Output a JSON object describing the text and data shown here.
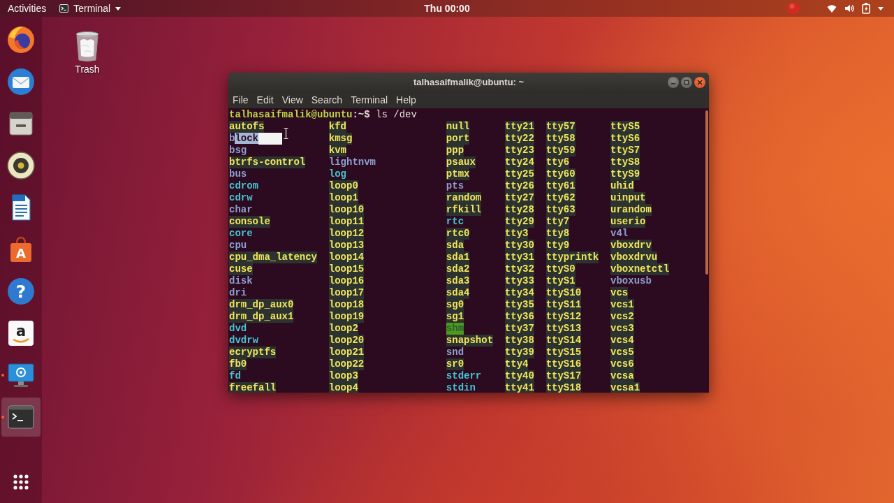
{
  "top_bar": {
    "activities": "Activities",
    "app_menu": "Terminal",
    "clock": "Thu 00:00"
  },
  "dock": {
    "items": [
      {
        "kind": "browser",
        "running": false,
        "active": false
      },
      {
        "kind": "mail",
        "running": false,
        "active": false
      },
      {
        "kind": "files",
        "running": false,
        "active": false
      },
      {
        "kind": "music",
        "running": false,
        "active": false
      },
      {
        "kind": "writer",
        "running": false,
        "active": false
      },
      {
        "kind": "store",
        "glyph": "A",
        "running": false,
        "active": false
      },
      {
        "kind": "help",
        "glyph": "?",
        "running": false,
        "active": false
      },
      {
        "kind": "amazon",
        "glyph": "a",
        "running": false,
        "active": false
      },
      {
        "kind": "screenshot",
        "running": true,
        "active": false
      },
      {
        "kind": "terminal",
        "running": true,
        "active": true
      }
    ]
  },
  "desktop_icons": [
    {
      "kind": "trash",
      "label": "Trash"
    }
  ],
  "terminal": {
    "title": "talhasaifmalik@ubuntu: ~",
    "menu": [
      "File",
      "Edit",
      "View",
      "Search",
      "Terminal",
      "Help"
    ],
    "prompt_user": "talhasaifmalik@ubuntu",
    "prompt_path": ":~$",
    "command": "ls /dev",
    "listing": {
      "columns": [
        {
          "entries": [
            {
              "name": "autofs",
              "kind": "device",
              "selected": false
            },
            {
              "name": "block",
              "kind": "directory",
              "selected": true
            },
            {
              "name": "bsg",
              "kind": "directory",
              "selected": false
            },
            {
              "name": "btrfs-control",
              "kind": "device",
              "selected": false
            },
            {
              "name": "bus",
              "kind": "directory",
              "selected": false
            },
            {
              "name": "cdrom",
              "kind": "symlink",
              "selected": false
            },
            {
              "name": "cdrw",
              "kind": "symlink",
              "selected": false
            },
            {
              "name": "char",
              "kind": "directory",
              "selected": false
            },
            {
              "name": "console",
              "kind": "device",
              "selected": false
            },
            {
              "name": "core",
              "kind": "symlink",
              "selected": false
            },
            {
              "name": "cpu",
              "kind": "directory",
              "selected": false
            },
            {
              "name": "cpu_dma_latency",
              "kind": "device",
              "selected": false
            },
            {
              "name": "cuse",
              "kind": "device",
              "selected": false
            },
            {
              "name": "disk",
              "kind": "directory",
              "selected": false
            },
            {
              "name": "dri",
              "kind": "directory",
              "selected": false
            },
            {
              "name": "drm_dp_aux0",
              "kind": "device",
              "selected": false
            },
            {
              "name": "drm_dp_aux1",
              "kind": "device",
              "selected": false
            },
            {
              "name": "dvd",
              "kind": "symlink",
              "selected": false
            },
            {
              "name": "dvdrw",
              "kind": "symlink",
              "selected": false
            },
            {
              "name": "ecryptfs",
              "kind": "device",
              "selected": false
            },
            {
              "name": "fb0",
              "kind": "device",
              "selected": false
            },
            {
              "name": "fd",
              "kind": "symlink",
              "selected": false
            },
            {
              "name": "freefall",
              "kind": "device",
              "selected": false
            }
          ]
        },
        {
          "entries": [
            {
              "name": "kfd",
              "kind": "device",
              "selected": false
            },
            {
              "name": "kmsg",
              "kind": "device",
              "selected": false
            },
            {
              "name": "kvm",
              "kind": "device",
              "selected": false
            },
            {
              "name": "lightnvm",
              "kind": "directory",
              "selected": false
            },
            {
              "name": "log",
              "kind": "symlink",
              "selected": false
            },
            {
              "name": "loop0",
              "kind": "device",
              "selected": false
            },
            {
              "name": "loop1",
              "kind": "device",
              "selected": false
            },
            {
              "name": "loop10",
              "kind": "device",
              "selected": false
            },
            {
              "name": "loop11",
              "kind": "device",
              "selected": false
            },
            {
              "name": "loop12",
              "kind": "device",
              "selected": false
            },
            {
              "name": "loop13",
              "kind": "device",
              "selected": false
            },
            {
              "name": "loop14",
              "kind": "device",
              "selected": false
            },
            {
              "name": "loop15",
              "kind": "device",
              "selected": false
            },
            {
              "name": "loop16",
              "kind": "device",
              "selected": false
            },
            {
              "name": "loop17",
              "kind": "device",
              "selected": false
            },
            {
              "name": "loop18",
              "kind": "device",
              "selected": false
            },
            {
              "name": "loop19",
              "kind": "device",
              "selected": false
            },
            {
              "name": "loop2",
              "kind": "device",
              "selected": false
            },
            {
              "name": "loop20",
              "kind": "device",
              "selected": false
            },
            {
              "name": "loop21",
              "kind": "device",
              "selected": false
            },
            {
              "name": "loop22",
              "kind": "device",
              "selected": false
            },
            {
              "name": "loop3",
              "kind": "device",
              "selected": false
            },
            {
              "name": "loop4",
              "kind": "device",
              "selected": false
            }
          ]
        },
        {
          "entries": [
            {
              "name": "null",
              "kind": "device",
              "selected": false
            },
            {
              "name": "port",
              "kind": "device",
              "selected": false
            },
            {
              "name": "ppp",
              "kind": "device",
              "selected": false
            },
            {
              "name": "psaux",
              "kind": "device",
              "selected": false
            },
            {
              "name": "ptmx",
              "kind": "device",
              "selected": false
            },
            {
              "name": "pts",
              "kind": "directory",
              "selected": false
            },
            {
              "name": "random",
              "kind": "device",
              "selected": false
            },
            {
              "name": "rfkill",
              "kind": "device",
              "selected": false
            },
            {
              "name": "rtc",
              "kind": "symlink",
              "selected": false
            },
            {
              "name": "rtc0",
              "kind": "device",
              "selected": false
            },
            {
              "name": "sda",
              "kind": "device",
              "selected": false
            },
            {
              "name": "sda1",
              "kind": "device",
              "selected": false
            },
            {
              "name": "sda2",
              "kind": "device",
              "selected": false
            },
            {
              "name": "sda3",
              "kind": "device",
              "selected": false
            },
            {
              "name": "sda4",
              "kind": "device",
              "selected": false
            },
            {
              "name": "sg0",
              "kind": "device",
              "selected": false
            },
            {
              "name": "sg1",
              "kind": "device",
              "selected": false
            },
            {
              "name": "shm",
              "kind": "sticky_dir",
              "selected": false
            },
            {
              "name": "snapshot",
              "kind": "device",
              "selected": false
            },
            {
              "name": "snd",
              "kind": "directory",
              "selected": false
            },
            {
              "name": "sr0",
              "kind": "device",
              "selected": false
            },
            {
              "name": "stderr",
              "kind": "symlink",
              "selected": false
            },
            {
              "name": "stdin",
              "kind": "symlink",
              "selected": false
            }
          ]
        },
        {
          "entries": [
            {
              "name": "tty21",
              "kind": "device",
              "selected": false
            },
            {
              "name": "tty22",
              "kind": "device",
              "selected": false
            },
            {
              "name": "tty23",
              "kind": "device",
              "selected": false
            },
            {
              "name": "tty24",
              "kind": "device",
              "selected": false
            },
            {
              "name": "tty25",
              "kind": "device",
              "selected": false
            },
            {
              "name": "tty26",
              "kind": "device",
              "selected": false
            },
            {
              "name": "tty27",
              "kind": "device",
              "selected": false
            },
            {
              "name": "tty28",
              "kind": "device",
              "selected": false
            },
            {
              "name": "tty29",
              "kind": "device",
              "selected": false
            },
            {
              "name": "tty3",
              "kind": "device",
              "selected": false
            },
            {
              "name": "tty30",
              "kind": "device",
              "selected": false
            },
            {
              "name": "tty31",
              "kind": "device",
              "selected": false
            },
            {
              "name": "tty32",
              "kind": "device",
              "selected": false
            },
            {
              "name": "tty33",
              "kind": "device",
              "selected": false
            },
            {
              "name": "tty34",
              "kind": "device",
              "selected": false
            },
            {
              "name": "tty35",
              "kind": "device",
              "selected": false
            },
            {
              "name": "tty36",
              "kind": "device",
              "selected": false
            },
            {
              "name": "tty37",
              "kind": "device",
              "selected": false
            },
            {
              "name": "tty38",
              "kind": "device",
              "selected": false
            },
            {
              "name": "tty39",
              "kind": "device",
              "selected": false
            },
            {
              "name": "tty4",
              "kind": "device",
              "selected": false
            },
            {
              "name": "tty40",
              "kind": "device",
              "selected": false
            },
            {
              "name": "tty41",
              "kind": "device",
              "selected": false
            }
          ]
        },
        {
          "entries": [
            {
              "name": "tty57",
              "kind": "device",
              "selected": false
            },
            {
              "name": "tty58",
              "kind": "device",
              "selected": false
            },
            {
              "name": "tty59",
              "kind": "device",
              "selected": false
            },
            {
              "name": "tty6",
              "kind": "device",
              "selected": false
            },
            {
              "name": "tty60",
              "kind": "device",
              "selected": false
            },
            {
              "name": "tty61",
              "kind": "device",
              "selected": false
            },
            {
              "name": "tty62",
              "kind": "device",
              "selected": false
            },
            {
              "name": "tty63",
              "kind": "device",
              "selected": false
            },
            {
              "name": "tty7",
              "kind": "device",
              "selected": false
            },
            {
              "name": "tty8",
              "kind": "device",
              "selected": false
            },
            {
              "name": "tty9",
              "kind": "device",
              "selected": false
            },
            {
              "name": "ttyprintk",
              "kind": "device",
              "selected": false
            },
            {
              "name": "ttyS0",
              "kind": "device",
              "selected": false
            },
            {
              "name": "ttyS1",
              "kind": "device",
              "selected": false
            },
            {
              "name": "ttyS10",
              "kind": "device",
              "selected": false
            },
            {
              "name": "ttyS11",
              "kind": "device",
              "selected": false
            },
            {
              "name": "ttyS12",
              "kind": "device",
              "selected": false
            },
            {
              "name": "ttyS13",
              "kind": "device",
              "selected": false
            },
            {
              "name": "ttyS14",
              "kind": "device",
              "selected": false
            },
            {
              "name": "ttyS15",
              "kind": "device",
              "selected": false
            },
            {
              "name": "ttyS16",
              "kind": "device",
              "selected": false
            },
            {
              "name": "ttyS17",
              "kind": "device",
              "selected": false
            },
            {
              "name": "ttyS18",
              "kind": "device",
              "selected": false
            }
          ]
        },
        {
          "entries": [
            {
              "name": "ttyS5",
              "kind": "device",
              "selected": false
            },
            {
              "name": "ttyS6",
              "kind": "device",
              "selected": false
            },
            {
              "name": "ttyS7",
              "kind": "device",
              "selected": false
            },
            {
              "name": "ttyS8",
              "kind": "device",
              "selected": false
            },
            {
              "name": "ttyS9",
              "kind": "device",
              "selected": false
            },
            {
              "name": "uhid",
              "kind": "device",
              "selected": false
            },
            {
              "name": "uinput",
              "kind": "device",
              "selected": false
            },
            {
              "name": "urandom",
              "kind": "device",
              "selected": false
            },
            {
              "name": "userio",
              "kind": "device",
              "selected": false
            },
            {
              "name": "v4l",
              "kind": "directory",
              "selected": false
            },
            {
              "name": "vboxdrv",
              "kind": "device",
              "selected": false
            },
            {
              "name": "vboxdrvu",
              "kind": "device",
              "selected": false
            },
            {
              "name": "vboxnetctl",
              "kind": "device",
              "selected": false
            },
            {
              "name": "vboxusb",
              "kind": "directory",
              "selected": false
            },
            {
              "name": "vcs",
              "kind": "device",
              "selected": false
            },
            {
              "name": "vcs1",
              "kind": "device",
              "selected": false
            },
            {
              "name": "vcs2",
              "kind": "device",
              "selected": false
            },
            {
              "name": "vcs3",
              "kind": "device",
              "selected": false
            },
            {
              "name": "vcs4",
              "kind": "device",
              "selected": false
            },
            {
              "name": "vcs5",
              "kind": "device",
              "selected": false
            },
            {
              "name": "vcs6",
              "kind": "device",
              "selected": false
            },
            {
              "name": "vcsa",
              "kind": "device",
              "selected": false
            },
            {
              "name": "vcsa1",
              "kind": "device",
              "selected": false
            }
          ]
        }
      ]
    }
  }
}
